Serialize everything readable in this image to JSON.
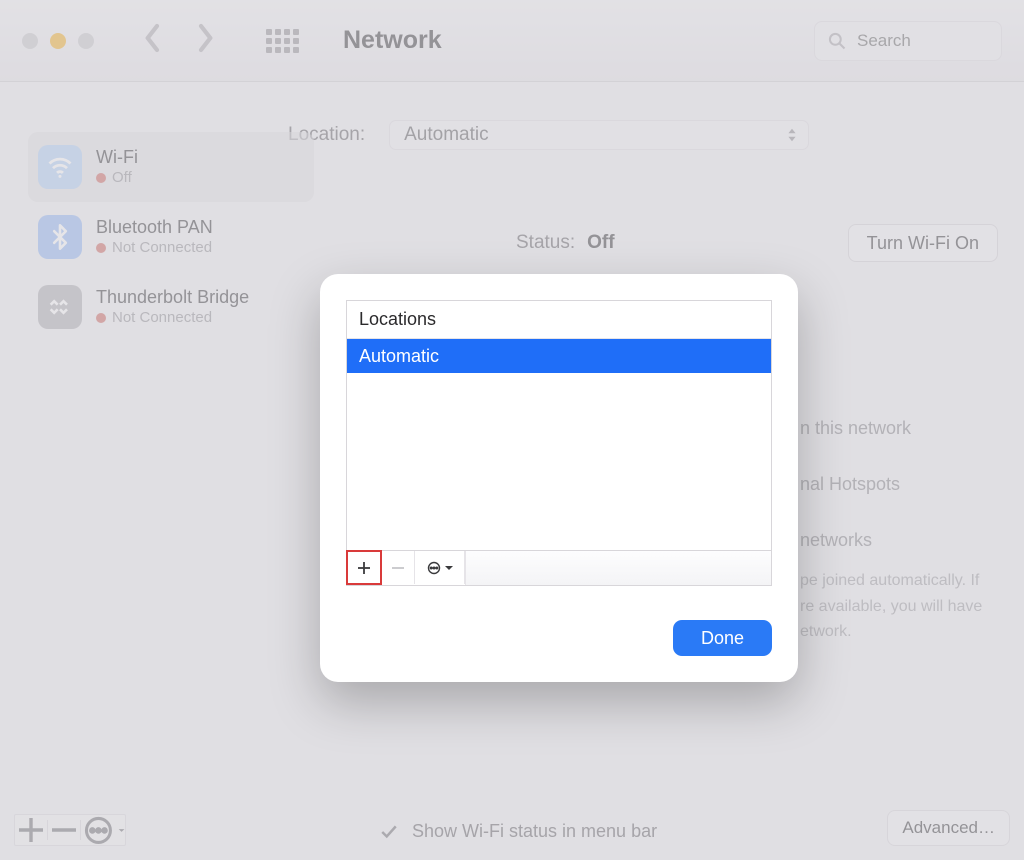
{
  "toolbar": {
    "title": "Network",
    "search_placeholder": "Search"
  },
  "location_label": "Location:",
  "location_value": "Automatic",
  "main": {
    "status_label": "Status:",
    "status_value": "Off",
    "wifi_button": "Turn Wi-Fi On",
    "hints": {
      "line1": "n this network",
      "line2": "nal Hotspots",
      "line3": "networks",
      "line4a": "pe joined automatically. If",
      "line4b": "re available, you will have",
      "line4c": "etwork."
    }
  },
  "services": [
    {
      "name": "Wi-Fi",
      "status": "Off"
    },
    {
      "name": "Bluetooth PAN",
      "status": "Not Connected"
    },
    {
      "name": "Thunderbolt Bridge",
      "status": "Not Connected"
    }
  ],
  "bottom": {
    "show_status": "Show Wi-Fi status in menu bar",
    "advanced": "Advanced…"
  },
  "modal": {
    "header": "Locations",
    "items": [
      "Automatic"
    ],
    "done": "Done"
  }
}
